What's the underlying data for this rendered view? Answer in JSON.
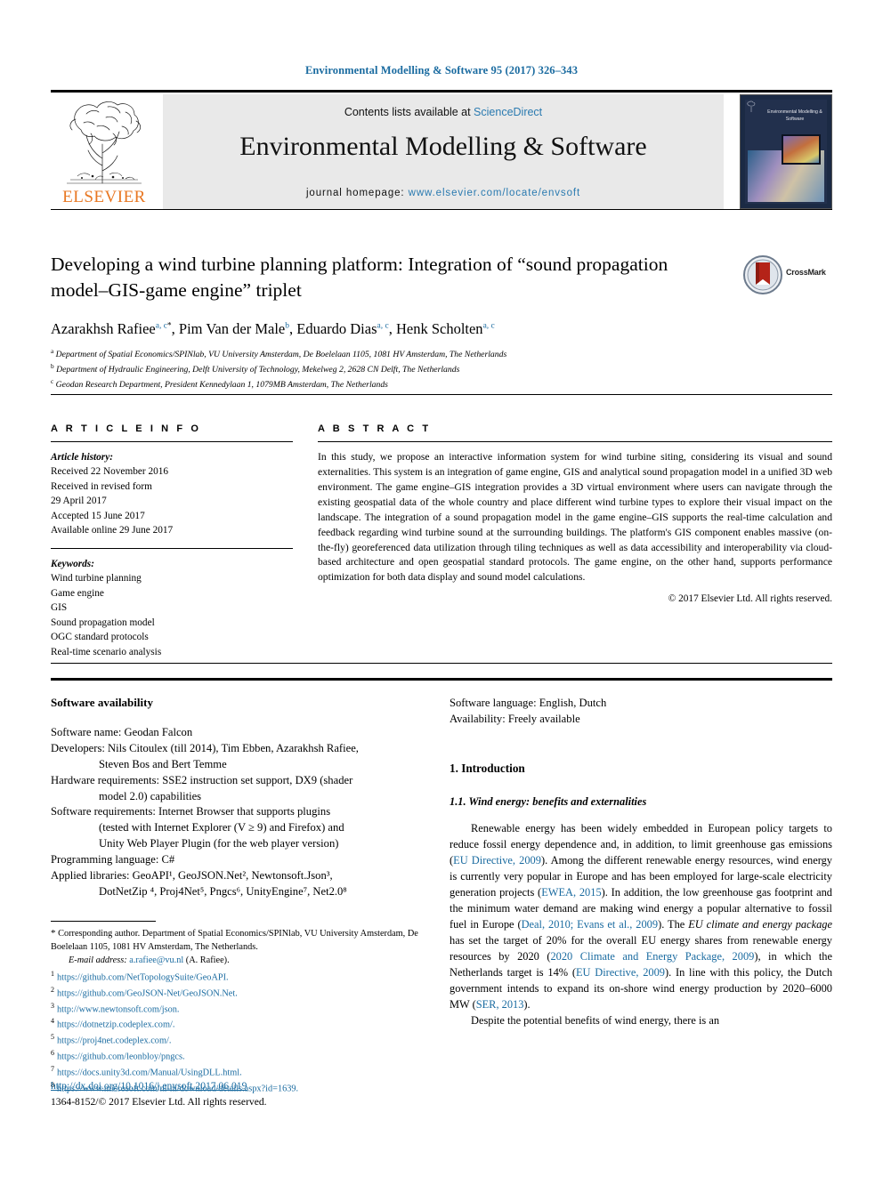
{
  "running_head": "Environmental Modelling & Software 95 (2017) 326–343",
  "masthead": {
    "contents_prefix": "Contents lists available at ",
    "contents_link": "ScienceDirect",
    "journal_title": "Environmental Modelling & Software",
    "homepage_prefix": "journal homepage: ",
    "homepage_link": "www.elsevier.com/locate/envsoft",
    "publisher": "ELSEVIER",
    "cover_title": "Environmental Modelling & Software"
  },
  "article": {
    "title": "Developing a wind turbine planning platform: Integration of “sound propagation model–GIS-game engine” triplet",
    "crossmark_label": "CrossMark",
    "authors": [
      {
        "name": "Azarakhsh Rafiee",
        "marks": "a, c",
        "corresponding": true
      },
      {
        "name": "Pim Van der Male",
        "marks": "b",
        "corresponding": false
      },
      {
        "name": "Eduardo Dias",
        "marks": "a, c",
        "corresponding": false
      },
      {
        "name": "Henk Scholten",
        "marks": "a, c",
        "corresponding": false
      }
    ],
    "affiliations": [
      {
        "mark": "a",
        "text": "Department of Spatial Economics/SPINlab, VU University Amsterdam, De Boelelaan 1105, 1081 HV Amsterdam, The Netherlands"
      },
      {
        "mark": "b",
        "text": "Department of Hydraulic Engineering, Delft University of Technology, Mekelweg 2, 2628 CN Delft, The Netherlands"
      },
      {
        "mark": "c",
        "text": "Geodan Research Department, President Kennedylaan 1, 1079MB Amsterdam, The Netherlands"
      }
    ]
  },
  "article_info": {
    "heading": "A R T I C L E  I N F O",
    "history_label": "Article history:",
    "history": [
      "Received 22 November 2016",
      "Received in revised form",
      "29 April 2017",
      "Accepted 15 June 2017",
      "Available online 29 June 2017"
    ],
    "keywords_label": "Keywords:",
    "keywords": [
      "Wind turbine planning",
      "Game engine",
      "GIS",
      "Sound propagation model",
      "OGC standard protocols",
      "Real-time scenario analysis"
    ]
  },
  "abstract": {
    "heading": "A B S T R A C T",
    "text": "In this study, we propose an interactive information system for wind turbine siting, considering its visual and sound externalities. This system is an integration of game engine, GIS and analytical sound propagation model in a unified 3D web environment. The game engine–GIS integration provides a 3D virtual environment where users can navigate through the existing geospatial data of the whole country and place different wind turbine types to explore their visual impact on the landscape. The integration of a sound propagation model in the game engine–GIS supports the real-time calculation and feedback regarding wind turbine sound at the surrounding buildings. The platform's GIS component enables massive (on-the-fly) georeferenced data utilization through tiling techniques as well as data accessibility and interoperability via cloud-based architecture and open geospatial standard protocols. The game engine, on the other hand, supports performance optimization for both data display and sound model calculations.",
    "copyright": "© 2017 Elsevier Ltd. All rights reserved."
  },
  "software_availability": {
    "heading": "Software availability",
    "name_label": "Software name:",
    "name_value": "Geodan Falcon",
    "developers_label": "Developers:",
    "developers_value": "Nils Citoulex (till 2014), Tim Ebben, Azarakhsh Rafiee,",
    "developers_cont": "Steven Bos and Bert Temme",
    "hardware_label": "Hardware requirements:",
    "hardware_value": "SSE2 instruction set support, DX9 (shader",
    "hardware_cont": "model 2.0) capabilities",
    "software_req_label": "Software requirements:",
    "software_req_value": "Internet Browser that supports plugins",
    "software_req_cont1": "(tested with Internet Explorer (V ≥ 9) and Firefox) and",
    "software_req_cont2": "Unity Web Player Plugin (for the web player version)",
    "prog_lang_label": "Programming language:",
    "prog_lang_value": "C#",
    "libraries_label": "Applied libraries:",
    "libraries_line1": "GeoAPI¹, GeoJSON.Net², Newtonsoft.Json³,",
    "libraries_line2": "DotNetZip ⁴, Proj4Net⁵, Pngcs⁶, UnityEngine⁷, Net2.0⁸",
    "language_label": "Software language:",
    "language_value": "English, Dutch",
    "availability_label": "Availability:",
    "availability_value": "Freely available"
  },
  "introduction": {
    "section_number_title": "1. Introduction",
    "subsection_title": "1.1. Wind energy: benefits and externalities",
    "paragraph1_parts": [
      {
        "t": "Renewable energy has been widely embedded in European policy targets to reduce fossil energy dependence and, in addition, to limit greenhouse gas emissions (",
        "k": "plain"
      },
      {
        "t": "EU Directive, 2009",
        "k": "link"
      },
      {
        "t": "). Among the different renewable energy resources, wind energy is currently very popular in Europe and has been employed for large-scale electricity generation projects (",
        "k": "plain"
      },
      {
        "t": "EWEA, 2015",
        "k": "link"
      },
      {
        "t": "). In addition, the low greenhouse gas footprint and the minimum water demand are making wind energy a popular alternative to fossil fuel in Europe (",
        "k": "plain"
      },
      {
        "t": "Deal, 2010; Evans et al., 2009",
        "k": "link"
      },
      {
        "t": "). The ",
        "k": "plain"
      },
      {
        "t": "EU climate and energy package",
        "k": "italic"
      },
      {
        "t": " has set the target of 20% for the overall EU energy shares from renewable energy resources by 2020 (",
        "k": "plain"
      },
      {
        "t": "2020 Climate and Energy Package, 2009",
        "k": "link"
      },
      {
        "t": "), in which the Netherlands target is 14% (",
        "k": "plain"
      },
      {
        "t": "EU Directive, 2009",
        "k": "link"
      },
      {
        "t": "). In line with this policy, the Dutch government intends to expand its on-shore wind energy production by 2020–6000 MW (",
        "k": "plain"
      },
      {
        "t": "SER, 2013",
        "k": "link"
      },
      {
        "t": ").",
        "k": "plain"
      }
    ],
    "paragraph2": "Despite the potential benefits of wind energy, there is an"
  },
  "footnotes": {
    "corresponding": "Corresponding author. Department of Spatial Economics/SPINlab, VU University Amsterdam, De Boelelaan 1105, 1081 HV Amsterdam, The Netherlands.",
    "email_label": "E-mail address:",
    "email_link": "a.rafiee@vu.nl",
    "email_suffix": "(A. Rafiee).",
    "items": [
      {
        "n": "1",
        "url": "https://github.com/NetTopologySuite/GeoAPI."
      },
      {
        "n": "2",
        "url": "https://github.com/GeoJSON-Net/GeoJSON.Net."
      },
      {
        "n": "3",
        "url": "http://www.newtonsoft.com/json."
      },
      {
        "n": "4",
        "url": "https://dotnetzip.codeplex.com/."
      },
      {
        "n": "5",
        "url": "https://proj4net.codeplex.com/."
      },
      {
        "n": "6",
        "url": "https://github.com/leonbloy/pngcs."
      },
      {
        "n": "7",
        "url": "https://docs.unity3d.com/Manual/UsingDLL.html."
      },
      {
        "n": "8",
        "url": "https://www.microsoft.com/nl-nl/download/details.aspx?id=1639."
      }
    ]
  },
  "footer": {
    "doi": "http://dx.doi.org/10.1016/j.envsoft.2017.06.019",
    "issn": "1364-8152/© 2017 Elsevier Ltd. All rights reserved."
  },
  "colors": {
    "link": "#1a6ba0",
    "elsevier_orange": "#e87722",
    "masthead_bg": "#e9e9e9"
  }
}
